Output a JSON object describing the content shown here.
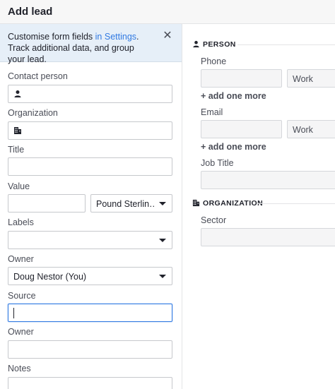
{
  "header": {
    "title": "Add lead"
  },
  "banner": {
    "text_before": "Customise form fields ",
    "link": "in Settings",
    "text_after": ". Track additional data, and group your lead."
  },
  "form": {
    "contact_person_label": "Contact person",
    "organization_label": "Organization",
    "title_label": "Title",
    "value_label": "Value",
    "currency_value": "Pound Sterlin…",
    "labels_label": "Labels",
    "owner_label": "Owner",
    "owner_value": "Doug Nestor (You)",
    "source_label": "Source",
    "owner2_label": "Owner",
    "notes_label": "Notes"
  },
  "person": {
    "section_title": "PERSON",
    "phone_label": "Phone",
    "phone_type": "Work",
    "add_phone": "+ add one more",
    "email_label": "Email",
    "email_type": "Work",
    "add_email": "+ add one more",
    "job_title_label": "Job Title"
  },
  "organization": {
    "section_title": "ORGANIZATION",
    "sector_label": "Sector"
  }
}
